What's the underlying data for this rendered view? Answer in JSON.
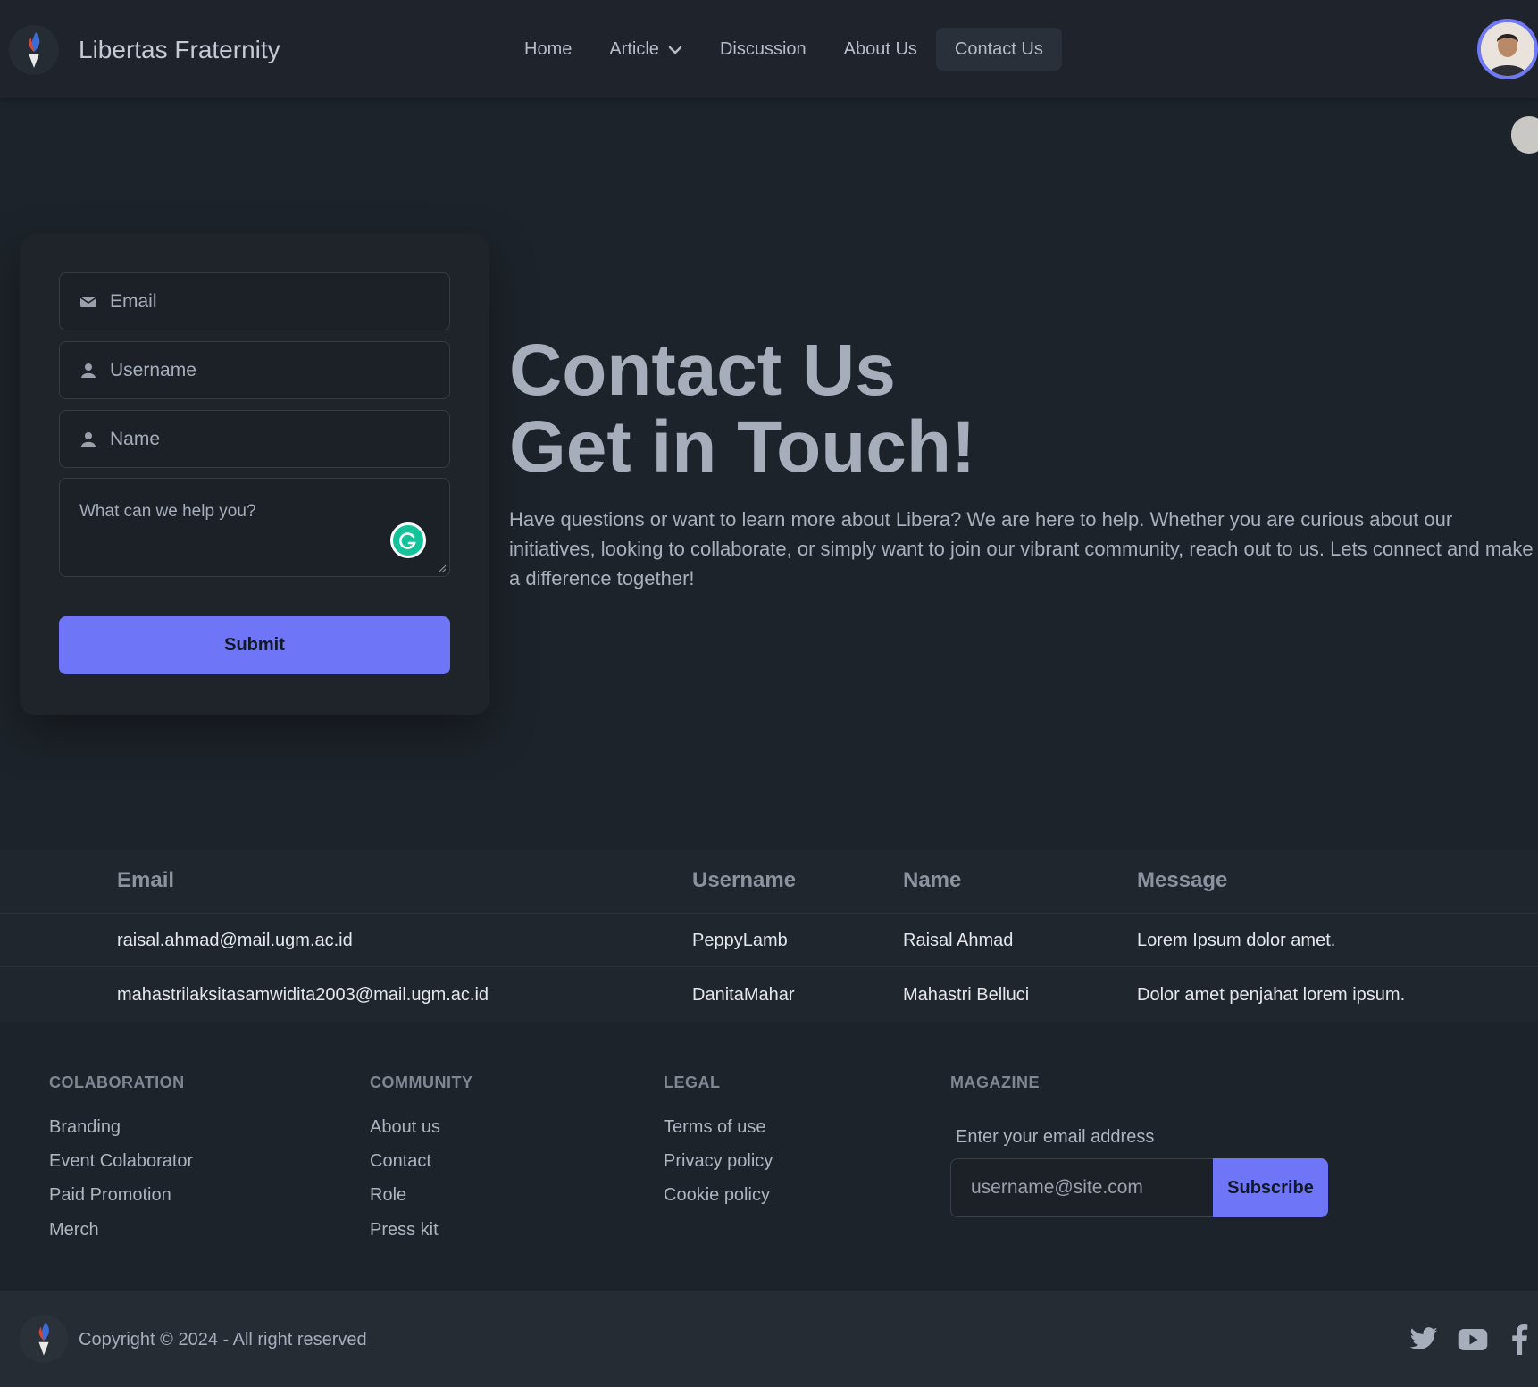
{
  "navbar": {
    "brand": "Libertas Fraternity",
    "links": [
      {
        "label": "Home"
      },
      {
        "label": "Article"
      },
      {
        "label": "Discussion"
      },
      {
        "label": "About Us"
      },
      {
        "label": "Contact Us"
      }
    ],
    "active": "Contact Us"
  },
  "form": {
    "email_placeholder": "Email",
    "username_placeholder": "Username",
    "name_placeholder": "Name",
    "message_placeholder": "What can we help you?",
    "submit_label": "Submit"
  },
  "hero": {
    "title_line1": "Contact Us",
    "title_line2": "Get in Touch!",
    "description": "Have questions or want to learn more about Libera? We are here to help. Whether you are curious about our initiatives, looking to collaborate, or simply want to join our vibrant community, reach out to us. Lets connect and make a difference together!"
  },
  "table": {
    "headers": [
      "Email",
      "Username",
      "Name",
      "Message"
    ],
    "rows": [
      [
        "raisal.ahmad@mail.ugm.ac.id",
        "PeppyLamb",
        "Raisal Ahmad",
        "Lorem Ipsum dolor amet."
      ],
      [
        "mahastrilaksitasamwidita2003@mail.ugm.ac.id",
        "DanitaMahar",
        "Mahastri Belluci",
        "Dolor amet penjahat lorem ipsum."
      ]
    ]
  },
  "footer": {
    "colaboration": {
      "title": "COLABORATION",
      "links": [
        "Branding",
        "Event Colaborator",
        "Paid Promotion",
        "Merch"
      ]
    },
    "community": {
      "title": "COMMUNITY",
      "links": [
        "About us",
        "Contact",
        "Role",
        "Press kit"
      ]
    },
    "legal": {
      "title": "LEGAL",
      "links": [
        "Terms of use",
        "Privacy policy",
        "Cookie policy"
      ]
    },
    "magazine": {
      "title": "MAGAZINE",
      "label": "Enter your email address",
      "placeholder": "username@site.com",
      "subscribe_label": "Subscribe"
    },
    "copyright": "Copyright © 2024 - All right reserved",
    "social_icons": [
      "twitter-icon",
      "youtube-icon",
      "facebook-icon"
    ]
  },
  "colors": {
    "background": "#1d232a",
    "accent": "#6e76f7",
    "card": "#1f242b"
  }
}
